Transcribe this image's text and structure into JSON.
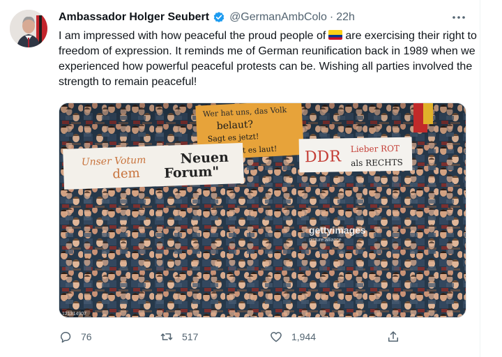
{
  "tweet": {
    "author_name": "Ambassador Holger Seubert",
    "handle": "@GermanAmbColo",
    "separator": "·",
    "time": "22h",
    "text_before_flag": "I am impressed with how peaceful the proud people of",
    "flag_icon": "colombia-flag",
    "text_after_flag": "are exercising their right to freedom of expression. It reminds me of German reunification back in 1989 when we experienced how powerful peaceful protests can be. Wishing all parties involved the strength to remain peaceful!"
  },
  "media": {
    "watermark": "gettyimages",
    "watermark_credit": "picture alliance",
    "image_id": "121314907",
    "signs": {
      "left_line1": "Unser Votum",
      "left_line2": "Neuen",
      "left_line3": "dem",
      "left_line4": "Forum\"",
      "center_line1": "Wer hat uns, das Volk",
      "center_line2": "belaut?",
      "center_line3": "Sagt es jetzt!",
      "center_line4": "Sagt es laut!",
      "right_line1": "DDR",
      "right_line2": "Lieber ROT",
      "right_line3": "als RECHTS"
    }
  },
  "actions": {
    "reply_count": "76",
    "retweet_count": "517",
    "like_count": "1,944"
  },
  "colors": {
    "verified": "#1d9bf0",
    "secondary_text": "#536471",
    "flag_yellow": "#fcd116",
    "flag_blue": "#003893",
    "flag_red": "#ce1126"
  }
}
